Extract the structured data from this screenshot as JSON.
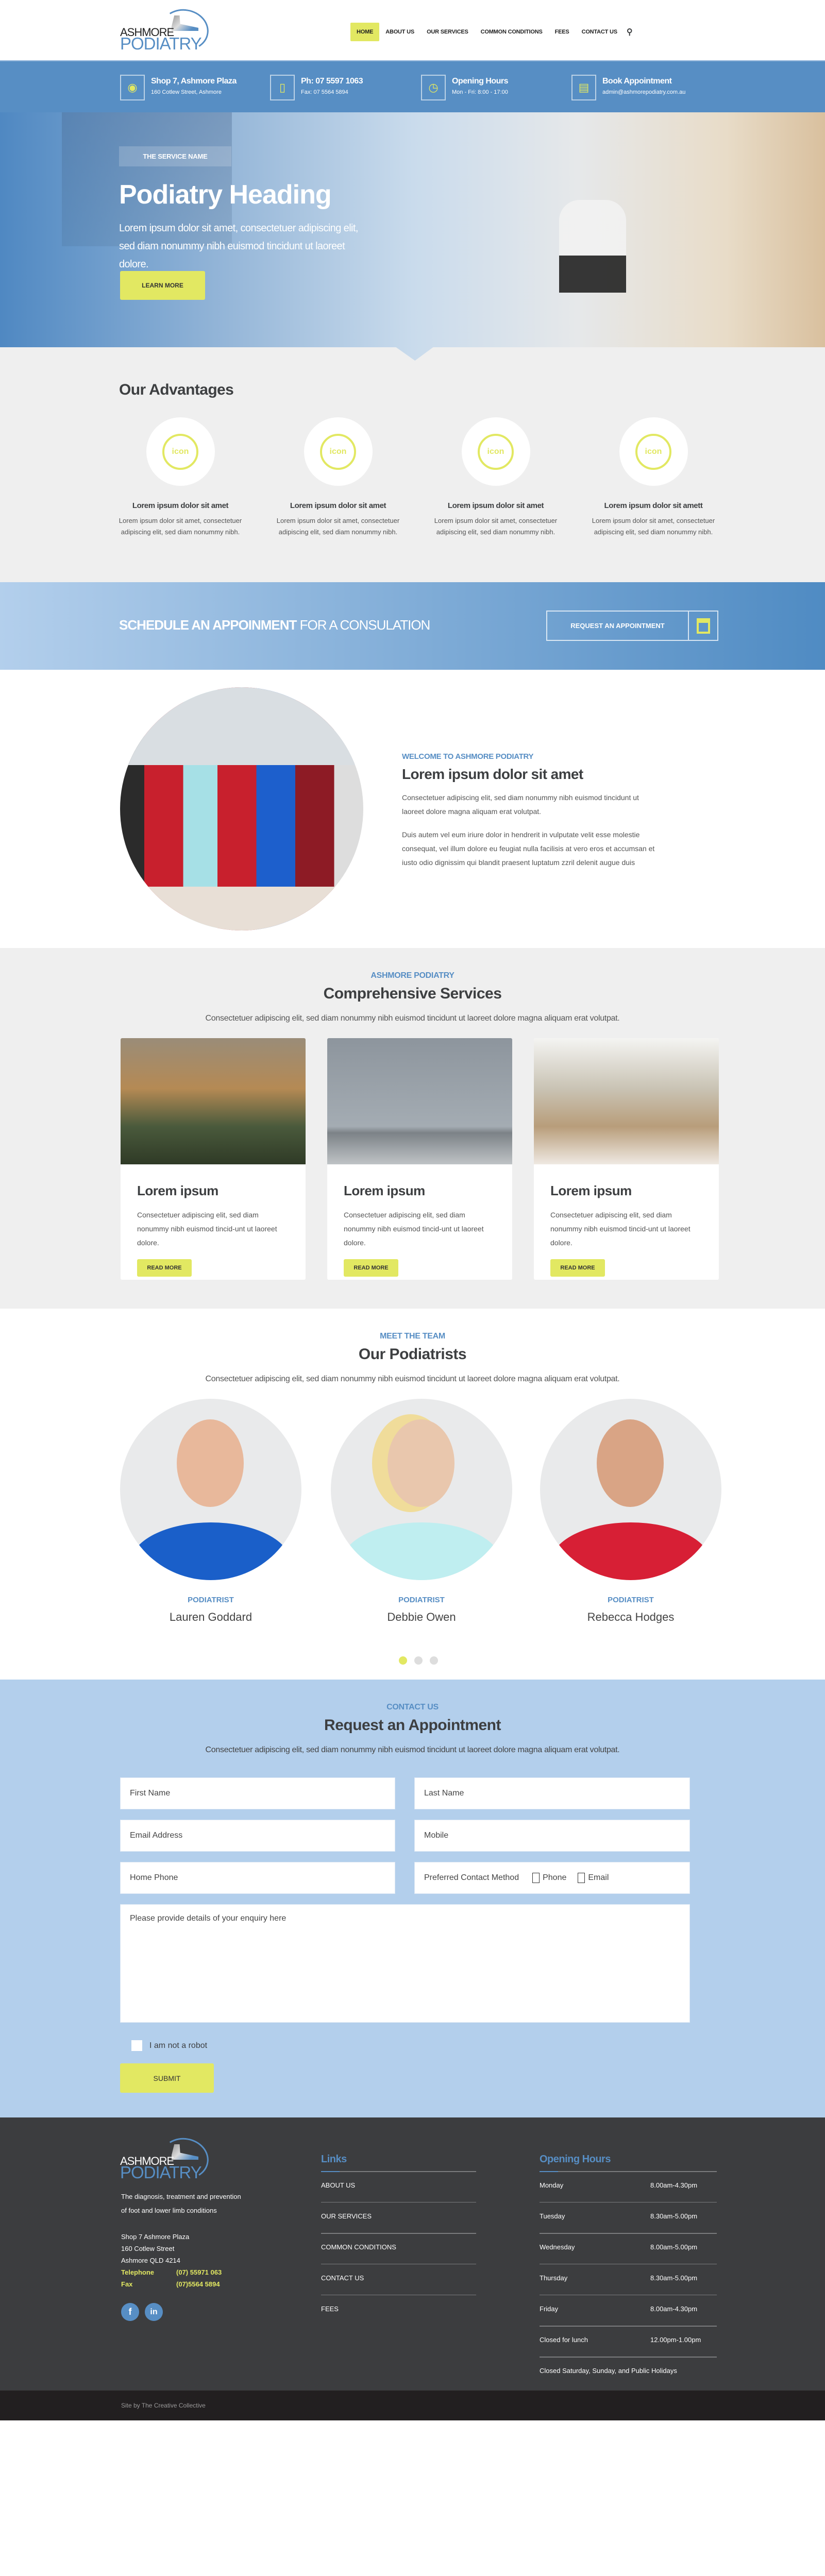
{
  "brand": {
    "line1": "ASHMORE",
    "line2": "PODIATRY"
  },
  "nav": {
    "items": [
      {
        "label": "HOME",
        "active": true
      },
      {
        "label": "ABOUT US"
      },
      {
        "label": "OUR SERVICES"
      },
      {
        "label": "COMMON CONDITIONS"
      },
      {
        "label": "FEES"
      },
      {
        "label": "CONTACT US"
      }
    ],
    "search_icon": "search-icon"
  },
  "infobar": [
    {
      "icon": "map-pin-icon",
      "title": "Shop 7, Ashmore Plaza",
      "sub": "160 Cotlew Street, Ashmore"
    },
    {
      "icon": "phone-icon",
      "title": "Ph: 07 5597 1063",
      "sub": "Fax: 07 5564 5894"
    },
    {
      "icon": "clock-icon",
      "title": "Opening Hours",
      "sub": "Mon - Fri: 8:00 - 17:00"
    },
    {
      "icon": "calendar-icon",
      "title": "Book Appointment",
      "sub": "admin@ashmorepodiatry.com.au"
    }
  ],
  "hero": {
    "badge": "THE SERVICE NAME",
    "heading": "Podiatry Heading",
    "text": "Lorem ipsum dolor sit amet, consectetuer adipiscing elit, sed diam nonummy nibh euismod tincidunt ut laoreet dolore.",
    "button": "LEARN MORE"
  },
  "advantages": {
    "title": "Our Advantages",
    "icon_text": "icon",
    "items": [
      {
        "title": "Lorem ipsum dolor sit amet",
        "text": "Lorem ipsum dolor sit amet, consectetuer adipiscing elit, sed diam nonummy nibh."
      },
      {
        "title": "Lorem ipsum dolor sit amet",
        "text": "Lorem ipsum dolor sit amet, consectetuer adipiscing elit, sed diam nonummy nibh."
      },
      {
        "title": "Lorem ipsum dolor sit amet",
        "text": "Lorem ipsum dolor sit amet, consectetuer adipiscing elit, sed diam nonummy nibh."
      },
      {
        "title": "Lorem ipsum dolor sit amett",
        "text": "Lorem ipsum dolor sit amet, consectetuer adipiscing elit, sed diam nonummy nibh."
      }
    ]
  },
  "cta": {
    "bold": "SCHEDULE AN APPOINMENT",
    "light": " FOR A CONSULATION",
    "button": "REQUEST AN APPOINTMENT"
  },
  "about": {
    "label": "WELCOME TO ASHMORE PODIATRY",
    "heading": "Lorem ipsum dolor sit amet",
    "p1": "Consectetuer adipiscing elit, sed diam nonummy nibh euismod tincidunt ut laoreet dolore magna aliquam erat volutpat.",
    "p2": "Duis autem vel eum iriure dolor in hendrerit in vulputate velit esse molestie consequat, vel illum dolore eu feugiat nulla facilisis at vero eros et accumsan et iusto odio dignissim qui blandit praesent luptatum zzril delenit augue duis"
  },
  "services": {
    "label": "ASHMORE PODIATRY",
    "heading": "Comprehensive Services",
    "text": "Consectetuer adipiscing elit, sed diam nonummy nibh euismod tincidunt ut laoreet dolore magna aliquam erat volutpat.",
    "cards": [
      {
        "title": "Lorem ipsum",
        "text": "Consectetuer adipiscing elit, sed diam nonummy nibh euismod tincid-unt ut laoreet dolore.",
        "button": "READ MORE"
      },
      {
        "title": "Lorem ipsum",
        "text": "Consectetuer adipiscing elit, sed diam nonummy nibh euismod tincid-unt ut laoreet dolore.",
        "button": "READ MORE"
      },
      {
        "title": "Lorem ipsum",
        "text": "Consectetuer adipiscing elit, sed diam nonummy nibh euismod tincid-unt ut laoreet dolore.",
        "button": "READ MORE"
      }
    ]
  },
  "team": {
    "label": "MEET THE TEAM",
    "heading": "Our Podiatrists",
    "text": "Consectetuer adipiscing elit, sed diam nonummy nibh euismod tincidunt ut laoreet dolore magna aliquam erat volutpat.",
    "members": [
      {
        "role": "PODIATRIST",
        "name": "Lauren Goddard",
        "shirt": "#1a5fc9"
      },
      {
        "role": "PODIATRIST",
        "name": "Debbie Owen",
        "shirt": "#bfeef0"
      },
      {
        "role": "PODIATRIST",
        "name": "Rebecca Hodges",
        "shirt": "#d71f35"
      }
    ],
    "carousel": {
      "pages": 3,
      "active": 1
    }
  },
  "contact": {
    "label": "CONTACT US",
    "heading": "Request an Appointment",
    "text": "Consectetuer adipiscing elit, sed diam nonummy nibh euismod tincidunt ut laoreet dolore magna aliquam erat volutpat.",
    "fields": {
      "first_name": "First Name",
      "last_name": "Last Name",
      "email": "Email Address",
      "mobile": "Mobile",
      "home_phone": "Home Phone",
      "preferred": "Preferred Contact Method",
      "opt_phone": "Phone",
      "opt_email": "Email",
      "enquiry": "Please provide details of your enquiry here"
    },
    "robot": "I am not a robot",
    "submit": "SUBMIT"
  },
  "footer": {
    "desc": "The diagnosis, treatment and prevention of foot and lower limb conditions",
    "address": [
      "Shop 7 Ashmore Plaza",
      "160 Cotlew Street",
      "Ashmore QLD 4214"
    ],
    "tel_label": "Telephone",
    "tel": "(07) 55971 063",
    "fax_label": "Fax",
    "fax": "(07)5564 5894",
    "social": [
      {
        "icon": "facebook-icon",
        "glyph": "f"
      },
      {
        "icon": "linkedin-icon",
        "glyph": "in"
      }
    ],
    "links_title": "Links",
    "links": [
      "ABOUT US",
      "OUR SERVICES",
      "COMMON CONDITIONS",
      "CONTACT US",
      "FEES"
    ],
    "hours_title": "Opening Hours",
    "hours": [
      [
        "Monday",
        "8.00am-4.30pm"
      ],
      [
        "Tuesday",
        "8.30am-5.00pm"
      ],
      [
        "Wednesday",
        "8.00am-5.00pm"
      ],
      [
        "Thursday",
        "8.30am-5.00pm"
      ],
      [
        "Friday",
        "8.00am-4.30pm"
      ],
      [
        "Closed for lunch",
        "12.00pm-1.00pm"
      ]
    ],
    "closed": "Closed Saturday, Sunday, and Public Holidays",
    "credit": "Site by The Creative Collective"
  },
  "colors": {
    "blue": "#578ec4",
    "yellow": "#e2e862",
    "light_blue": "#b3cfec",
    "dark": "#3c3d3f"
  }
}
